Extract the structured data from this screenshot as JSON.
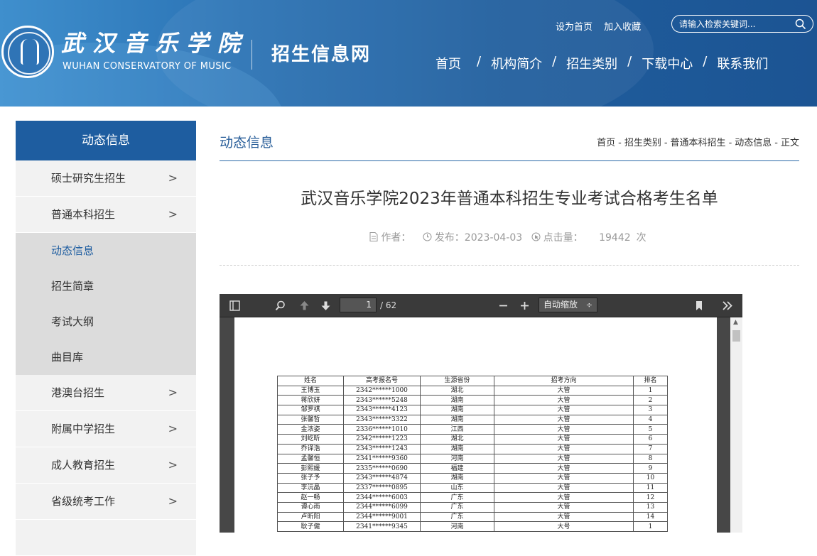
{
  "header": {
    "school_name_cn": "武汉音乐学院",
    "school_name_en": "WUHAN CONSERVATORY OF MUSIC",
    "site_title": "招生信息网",
    "top_links": [
      "设为首页",
      "加入收藏"
    ],
    "search_placeholder": "请输入检索关键词...",
    "nav": [
      "首页",
      "机构简介",
      "招生类别",
      "下载中心",
      "联系我们"
    ],
    "nav_separator": "/"
  },
  "sidebar": {
    "title": "动态信息",
    "items": [
      {
        "label": "硕士研究生招生",
        "chevron": ">"
      },
      {
        "label": "普通本科招生",
        "chevron": ">"
      }
    ],
    "sub_items": [
      {
        "label": "动态信息",
        "active": true
      },
      {
        "label": "招生简章",
        "active": false
      },
      {
        "label": "考试大纲",
        "active": false
      },
      {
        "label": "曲目库",
        "active": false
      }
    ],
    "items_after": [
      {
        "label": "港澳台招生",
        "chevron": ">"
      },
      {
        "label": "附属中学招生",
        "chevron": ">"
      },
      {
        "label": "成人教育招生",
        "chevron": ">"
      },
      {
        "label": "省级统考工作",
        "chevron": ">"
      }
    ]
  },
  "content": {
    "category": "动态信息",
    "breadcrumb": [
      "首页",
      "招生类别",
      "普通本科招生",
      "动态信息",
      "正文"
    ],
    "breadcrumb_sep": "-",
    "title": "武汉音乐学院2023年普通本科招生专业考试合格考生名单",
    "meta": {
      "author_label": "作者：",
      "date_label": "发布：2023-04-03",
      "clicks_label": "点击量：",
      "clicks_value": "19442",
      "clicks_unit": "次"
    }
  },
  "pdf_viewer": {
    "page_current": "1",
    "page_total": "/ 62",
    "zoom": "自动缩放",
    "zoom_arrow": "÷",
    "table_headers": [
      "姓名",
      "高考报名号",
      "生源省份",
      "招考方向",
      "排名"
    ],
    "rows": [
      [
        "王博玉",
        "2342******1000",
        "湖北",
        "大管",
        "1"
      ],
      [
        "蒋欣妍",
        "2343******5248",
        "湖南",
        "大管",
        "2"
      ],
      [
        "邹罗祺",
        "2343******4123",
        "湖南",
        "大管",
        "3"
      ],
      [
        "张馨哲",
        "2343******3322",
        "湖南",
        "大管",
        "4"
      ],
      [
        "金浓姿",
        "2336******1010",
        "江西",
        "大管",
        "5"
      ],
      [
        "刘屹昕",
        "2342******1223",
        "湖北",
        "大管",
        "6"
      ],
      [
        "乔译浩",
        "2343******1243",
        "湖南",
        "大管",
        "7"
      ],
      [
        "孟馨恒",
        "2341******9360",
        "河南",
        "大管",
        "8"
      ],
      [
        "彭熙媛",
        "2335******0690",
        "福建",
        "大管",
        "9"
      ],
      [
        "张子予",
        "2343******4874",
        "湖南",
        "大管",
        "10"
      ],
      [
        "李沅晶",
        "2337******0895",
        "山东",
        "大管",
        "11"
      ],
      [
        "赵一畅",
        "2344******6003",
        "广东",
        "大管",
        "12"
      ],
      [
        "谭心雨",
        "2344******6099",
        "广东",
        "大管",
        "13"
      ],
      [
        "卢昕阳",
        "2344******9001",
        "广东",
        "大管",
        "14"
      ],
      [
        "耿子健",
        "2341******9345",
        "河南",
        "大号",
        "1"
      ]
    ]
  }
}
